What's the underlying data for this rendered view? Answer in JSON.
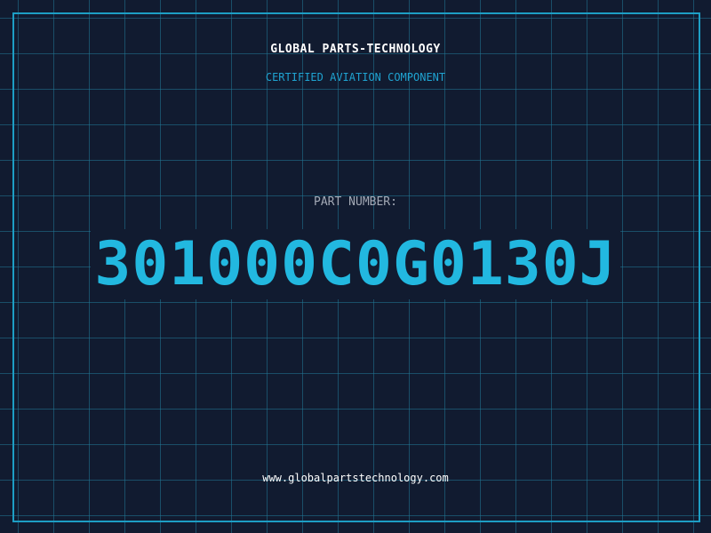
{
  "header": {
    "company": "GLOBAL PARTS-TECHNOLOGY",
    "tagline": "CERTIFIED AVIATION COMPONENT"
  },
  "part": {
    "label": "PART NUMBER:",
    "number": "301000C0G0130J"
  },
  "footer": {
    "website": "www.globalpartstechnology.com"
  },
  "colors": {
    "background": "#111b30",
    "grid": "#207896",
    "accent": "#22b8e0",
    "text": "#ffffff",
    "label": "#a4aab6"
  }
}
